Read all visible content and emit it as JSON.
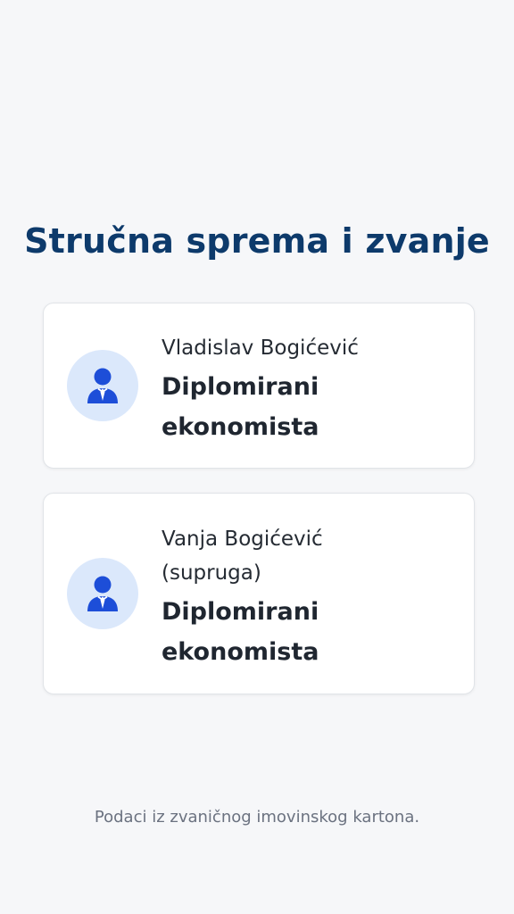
{
  "page": {
    "title": "Stručna sprema i zvanje",
    "footer": "Podaci iz zvaničnog imovinskog kartona."
  },
  "cards": [
    {
      "name": "Vladislav Bogićević",
      "degree_line1": "Diplomirani",
      "degree_line2": "ekonomista",
      "icon": "person-tie-icon"
    },
    {
      "name_line1": "Vanja Bogićević",
      "name_line2": "(supruga)",
      "degree_line1": "Diplomirani",
      "degree_line2": "ekonomista",
      "icon": "person-tie-icon"
    }
  ],
  "colors": {
    "background": "#f6f7f9",
    "title": "#0d3a6b",
    "avatar_bg": "#dbe8fb",
    "avatar_icon": "#1d4ed8"
  }
}
